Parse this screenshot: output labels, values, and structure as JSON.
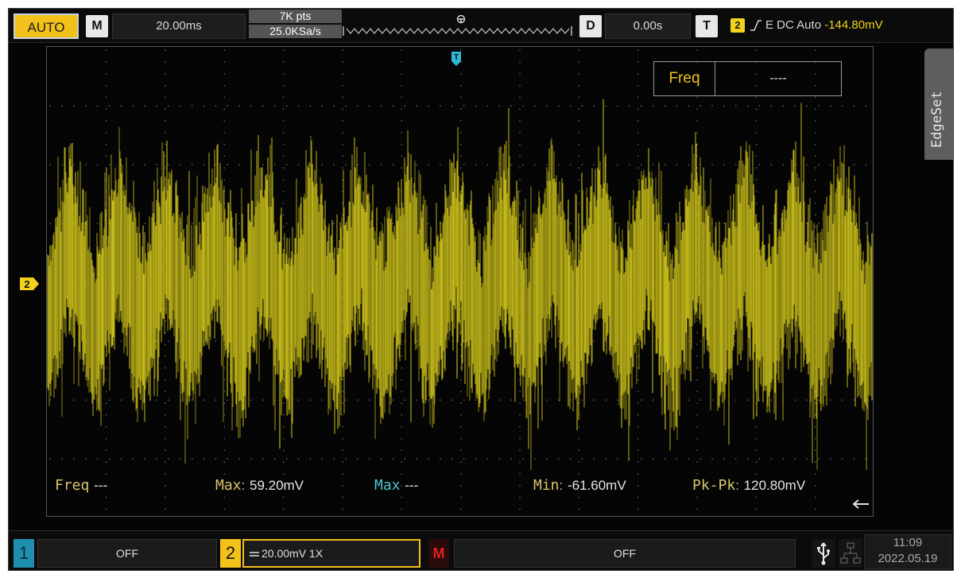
{
  "topbar": {
    "mode_label": "AUTO",
    "menu_key": "M",
    "timebase": "20.00ms",
    "memory_depth": "7K pts",
    "sample_rate": "25.0KSa/s",
    "delay_key": "D",
    "delay_value": "0.00s",
    "trigger_key": "T",
    "trigger_channel": "2",
    "trigger_settings": "E DC Auto",
    "trigger_level": "-144.80mV"
  },
  "display": {
    "channel_marker": "2",
    "trigger_marker": "T",
    "side_tab": "EdgeSet",
    "freq_box": {
      "label": "Freq",
      "value": "----"
    }
  },
  "measurements": {
    "freq_label": "Freq",
    "freq_value": "---",
    "max_label": "Max",
    "max_value": "59.20mV",
    "max2_label": "Max",
    "max2_value": "---",
    "min_label": "Min",
    "min_value": "-61.60mV",
    "pkpk_label": "Pk-Pk",
    "pkpk_value": "120.80mV"
  },
  "bottombar": {
    "ch1_num": "1",
    "ch1_state": "OFF",
    "ch2_num": "2",
    "ch2_setting": "20.00mV 1X",
    "math_key": "M",
    "math_state": "OFF",
    "time": "11:09",
    "date": "2022.05.19"
  },
  "colors": {
    "trace": "#d8cc1c",
    "accent": "#f2c21b",
    "trigger_marker": "#2fb8d8",
    "math": "#e02020"
  },
  "icons": {
    "timebase_key": "m-key-icon",
    "delay_key": "d-key-icon",
    "trigger_key": "t-key-icon",
    "edge": "rising-edge-icon",
    "usb": "usb-icon",
    "lan": "lan-icon"
  }
}
